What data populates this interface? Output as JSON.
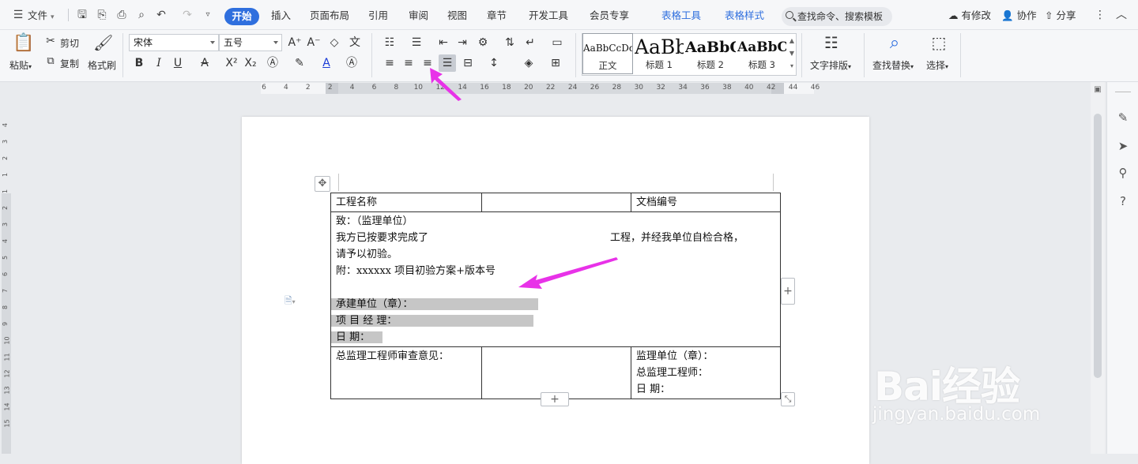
{
  "menubar": {
    "file_label": "文件",
    "tabs": [
      "开始",
      "插入",
      "页面布局",
      "引用",
      "审阅",
      "视图",
      "章节",
      "开发工具",
      "会员专享",
      "表格工具",
      "表格样式"
    ],
    "search_placeholder": "查找命令、搜索模板",
    "modified_label": "有修改",
    "collab_label": "协作",
    "share_label": "分享"
  },
  "ribbon": {
    "paste_label": "粘贴",
    "cut_label": "剪切",
    "copy_label": "复制",
    "format_painter_label": "格式刷",
    "font_name": "宋体",
    "font_size": "五号",
    "styles": [
      {
        "sample": "AaBbCcDd",
        "label": "正文"
      },
      {
        "sample": "AaBb",
        "label": "标题 1"
      },
      {
        "sample": "AaBbC",
        "label": "标题 2"
      },
      {
        "sample": "AaBbC",
        "label": "标题 3"
      }
    ],
    "text_layout_label": "文字排版",
    "find_replace_label": "查找替换",
    "select_label": "选择"
  },
  "ruler": {
    "ticks": [
      "6",
      "4",
      "2",
      "2",
      "4",
      "6",
      "8",
      "10",
      "12",
      "14",
      "16",
      "18",
      "20",
      "22",
      "24",
      "26",
      "28",
      "30",
      "32",
      "34",
      "36",
      "38",
      "40",
      "42",
      "44",
      "46"
    ]
  },
  "vruler": {
    "ticks": [
      "4",
      "3",
      "2",
      "1",
      "1",
      "2",
      "3",
      "4",
      "5",
      "6",
      "7",
      "8",
      "9",
      "10",
      "11",
      "12",
      "13",
      "14",
      "15"
    ]
  },
  "table": {
    "row1": {
      "c1": "工程名称",
      "c2": "",
      "c3": "文档编号",
      "c4": ""
    },
    "row2": {
      "line1": "致：（监理单位）",
      "line2_left": "我方已按要求完成了",
      "line2_right": "工程，并经我单位自检合格，",
      "line3": "请予以初验。",
      "line4": "附：xxxxxx 项目初验方案+版本号",
      "line6": "承建单位（章）：",
      "line7": "项 目 经 理：",
      "line8": "日       期："
    },
    "row3": {
      "c1": "总监理工程师审查意见：",
      "c2": "",
      "c3_line1": "监理单位（章）：",
      "c3_line2": "总监理工程师：",
      "c3_line3": "日        期："
    }
  },
  "watermark": {
    "logo": "Bai经验",
    "url": "jingyan.baidu.com"
  },
  "colors": {
    "accent": "#2f6fde",
    "arrow": "#e832e8",
    "highlight": "#c6c6c6"
  }
}
